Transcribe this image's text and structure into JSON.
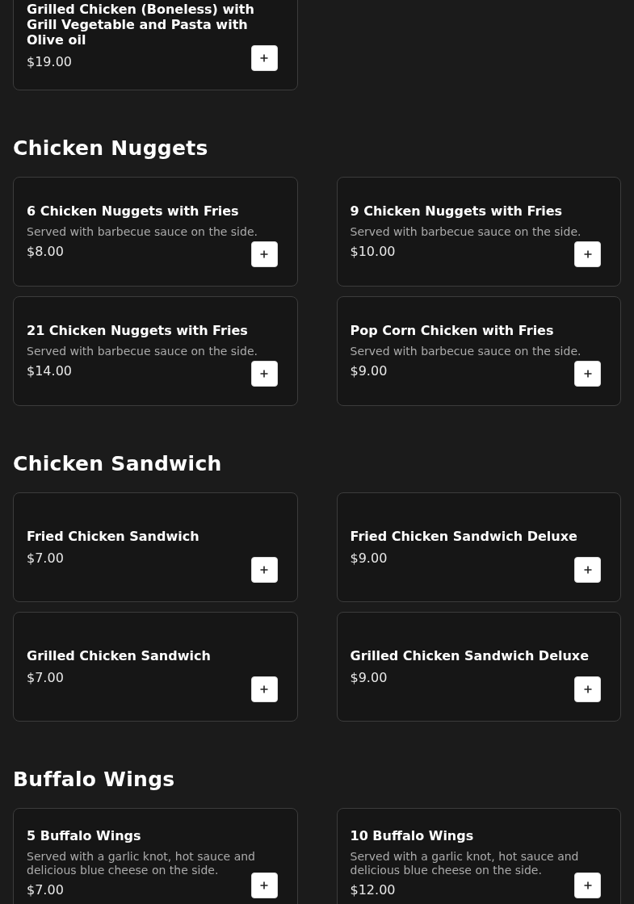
{
  "sections": [
    {
      "items": [
        {
          "name": "Grilled Chicken (Boneless) with Grill Vegetable and Pasta with Olive oil",
          "price": "$19.00"
        }
      ]
    },
    {
      "title": "Chicken Nuggets",
      "items": [
        {
          "name": "6 Chicken Nuggets with Fries",
          "description": "Served with barbecue sauce on the side.",
          "price": "$8.00"
        },
        {
          "name": "9 Chicken Nuggets with Fries",
          "description": "Served with barbecue sauce on the side.",
          "price": "$10.00"
        },
        {
          "name": "21 Chicken Nuggets with Fries",
          "description": "Served with barbecue sauce on the side.",
          "price": "$14.00"
        },
        {
          "name": "Pop Corn Chicken with Fries",
          "description": "Served with barbecue sauce on the side.",
          "price": "$9.00"
        }
      ]
    },
    {
      "title": "Chicken Sandwich",
      "items": [
        {
          "name": "Fried Chicken Sandwich",
          "price": "$7.00"
        },
        {
          "name": "Fried Chicken Sandwich Deluxe",
          "price": "$9.00"
        },
        {
          "name": "Grilled Chicken Sandwich",
          "price": "$7.00"
        },
        {
          "name": "Grilled Chicken Sandwich Deluxe",
          "price": "$9.00"
        }
      ]
    },
    {
      "title": "Buffalo Wings",
      "items": [
        {
          "name": "5 Buffalo Wings",
          "description": "Served with a garlic knot, hot sauce and delicious blue cheese on the side.",
          "price": "$7.00"
        },
        {
          "name": "10 Buffalo Wings",
          "description": "Served with a garlic knot, hot sauce and delicious blue cheese on the side.",
          "price": "$12.00"
        }
      ]
    }
  ]
}
